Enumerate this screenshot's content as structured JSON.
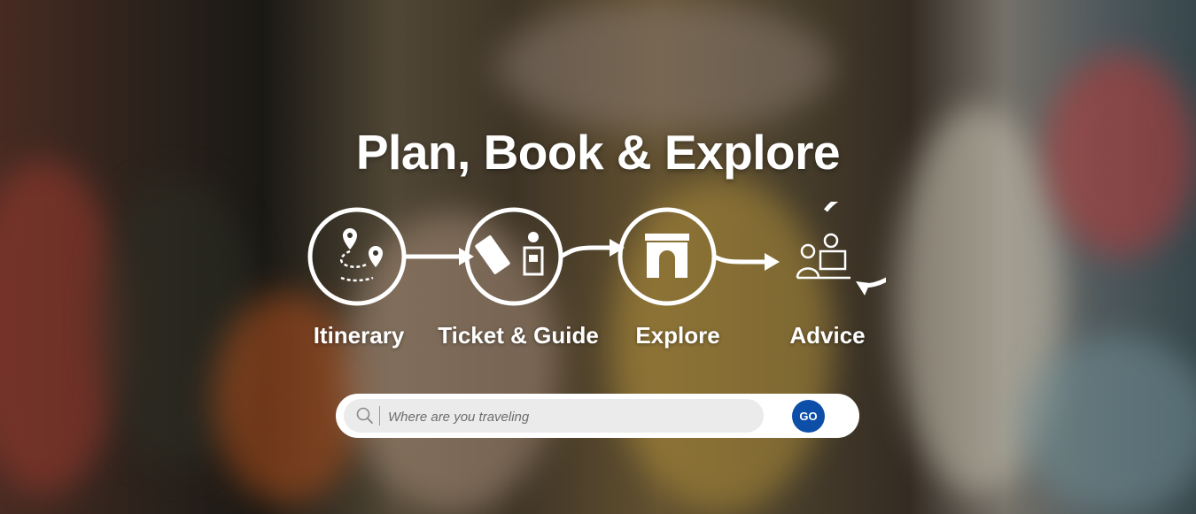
{
  "hero": {
    "title": "Plan, Book & Explore"
  },
  "steps": [
    {
      "label": "Itinerary",
      "icon": "map-route-icon"
    },
    {
      "label": "Ticket & Guide",
      "icon": "ticket-guide-icon"
    },
    {
      "label": "Explore",
      "icon": "monument-gate-icon"
    },
    {
      "label": "Advice",
      "icon": "advisor-icon"
    }
  ],
  "search": {
    "placeholder": "Where are you traveling",
    "value": "",
    "go_label": "GO"
  },
  "colors": {
    "go_button": "#0d4fa8",
    "search_field": "#ebebeb",
    "text": "#ffffff"
  }
}
